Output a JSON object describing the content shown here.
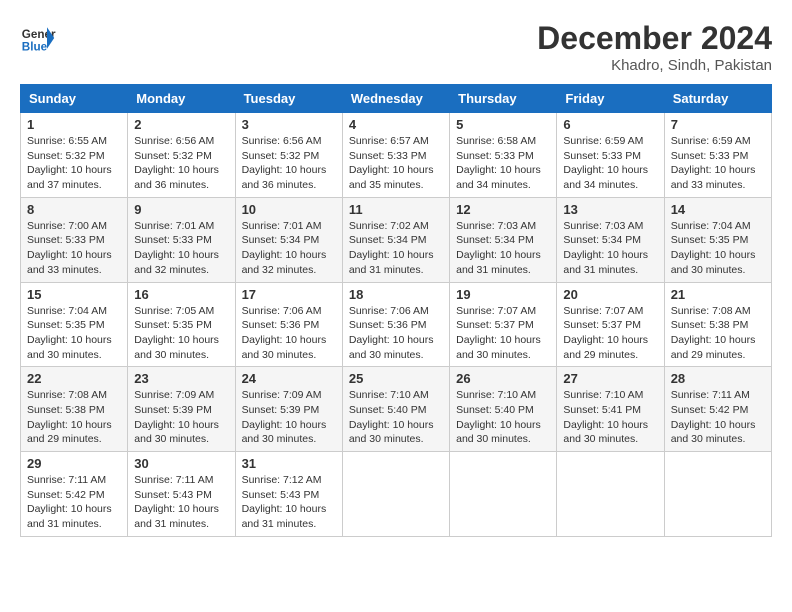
{
  "logo": {
    "general": "General",
    "blue": "Blue"
  },
  "header": {
    "month": "December 2024",
    "location": "Khadro, Sindh, Pakistan"
  },
  "weekdays": [
    "Sunday",
    "Monday",
    "Tuesday",
    "Wednesday",
    "Thursday",
    "Friday",
    "Saturday"
  ],
  "weeks": [
    [
      {
        "day": "1",
        "sunrise": "6:55 AM",
        "sunset": "5:32 PM",
        "daylight": "10 hours and 37 minutes."
      },
      {
        "day": "2",
        "sunrise": "6:56 AM",
        "sunset": "5:32 PM",
        "daylight": "10 hours and 36 minutes."
      },
      {
        "day": "3",
        "sunrise": "6:56 AM",
        "sunset": "5:32 PM",
        "daylight": "10 hours and 36 minutes."
      },
      {
        "day": "4",
        "sunrise": "6:57 AM",
        "sunset": "5:33 PM",
        "daylight": "10 hours and 35 minutes."
      },
      {
        "day": "5",
        "sunrise": "6:58 AM",
        "sunset": "5:33 PM",
        "daylight": "10 hours and 34 minutes."
      },
      {
        "day": "6",
        "sunrise": "6:59 AM",
        "sunset": "5:33 PM",
        "daylight": "10 hours and 34 minutes."
      },
      {
        "day": "7",
        "sunrise": "6:59 AM",
        "sunset": "5:33 PM",
        "daylight": "10 hours and 33 minutes."
      }
    ],
    [
      {
        "day": "8",
        "sunrise": "7:00 AM",
        "sunset": "5:33 PM",
        "daylight": "10 hours and 33 minutes."
      },
      {
        "day": "9",
        "sunrise": "7:01 AM",
        "sunset": "5:33 PM",
        "daylight": "10 hours and 32 minutes."
      },
      {
        "day": "10",
        "sunrise": "7:01 AM",
        "sunset": "5:34 PM",
        "daylight": "10 hours and 32 minutes."
      },
      {
        "day": "11",
        "sunrise": "7:02 AM",
        "sunset": "5:34 PM",
        "daylight": "10 hours and 31 minutes."
      },
      {
        "day": "12",
        "sunrise": "7:03 AM",
        "sunset": "5:34 PM",
        "daylight": "10 hours and 31 minutes."
      },
      {
        "day": "13",
        "sunrise": "7:03 AM",
        "sunset": "5:34 PM",
        "daylight": "10 hours and 31 minutes."
      },
      {
        "day": "14",
        "sunrise": "7:04 AM",
        "sunset": "5:35 PM",
        "daylight": "10 hours and 30 minutes."
      }
    ],
    [
      {
        "day": "15",
        "sunrise": "7:04 AM",
        "sunset": "5:35 PM",
        "daylight": "10 hours and 30 minutes."
      },
      {
        "day": "16",
        "sunrise": "7:05 AM",
        "sunset": "5:35 PM",
        "daylight": "10 hours and 30 minutes."
      },
      {
        "day": "17",
        "sunrise": "7:06 AM",
        "sunset": "5:36 PM",
        "daylight": "10 hours and 30 minutes."
      },
      {
        "day": "18",
        "sunrise": "7:06 AM",
        "sunset": "5:36 PM",
        "daylight": "10 hours and 30 minutes."
      },
      {
        "day": "19",
        "sunrise": "7:07 AM",
        "sunset": "5:37 PM",
        "daylight": "10 hours and 30 minutes."
      },
      {
        "day": "20",
        "sunrise": "7:07 AM",
        "sunset": "5:37 PM",
        "daylight": "10 hours and 29 minutes."
      },
      {
        "day": "21",
        "sunrise": "7:08 AM",
        "sunset": "5:38 PM",
        "daylight": "10 hours and 29 minutes."
      }
    ],
    [
      {
        "day": "22",
        "sunrise": "7:08 AM",
        "sunset": "5:38 PM",
        "daylight": "10 hours and 29 minutes."
      },
      {
        "day": "23",
        "sunrise": "7:09 AM",
        "sunset": "5:39 PM",
        "daylight": "10 hours and 30 minutes."
      },
      {
        "day": "24",
        "sunrise": "7:09 AM",
        "sunset": "5:39 PM",
        "daylight": "10 hours and 30 minutes."
      },
      {
        "day": "25",
        "sunrise": "7:10 AM",
        "sunset": "5:40 PM",
        "daylight": "10 hours and 30 minutes."
      },
      {
        "day": "26",
        "sunrise": "7:10 AM",
        "sunset": "5:40 PM",
        "daylight": "10 hours and 30 minutes."
      },
      {
        "day": "27",
        "sunrise": "7:10 AM",
        "sunset": "5:41 PM",
        "daylight": "10 hours and 30 minutes."
      },
      {
        "day": "28",
        "sunrise": "7:11 AM",
        "sunset": "5:42 PM",
        "daylight": "10 hours and 30 minutes."
      }
    ],
    [
      {
        "day": "29",
        "sunrise": "7:11 AM",
        "sunset": "5:42 PM",
        "daylight": "10 hours and 31 minutes."
      },
      {
        "day": "30",
        "sunrise": "7:11 AM",
        "sunset": "5:43 PM",
        "daylight": "10 hours and 31 minutes."
      },
      {
        "day": "31",
        "sunrise": "7:12 AM",
        "sunset": "5:43 PM",
        "daylight": "10 hours and 31 minutes."
      },
      null,
      null,
      null,
      null
    ]
  ]
}
